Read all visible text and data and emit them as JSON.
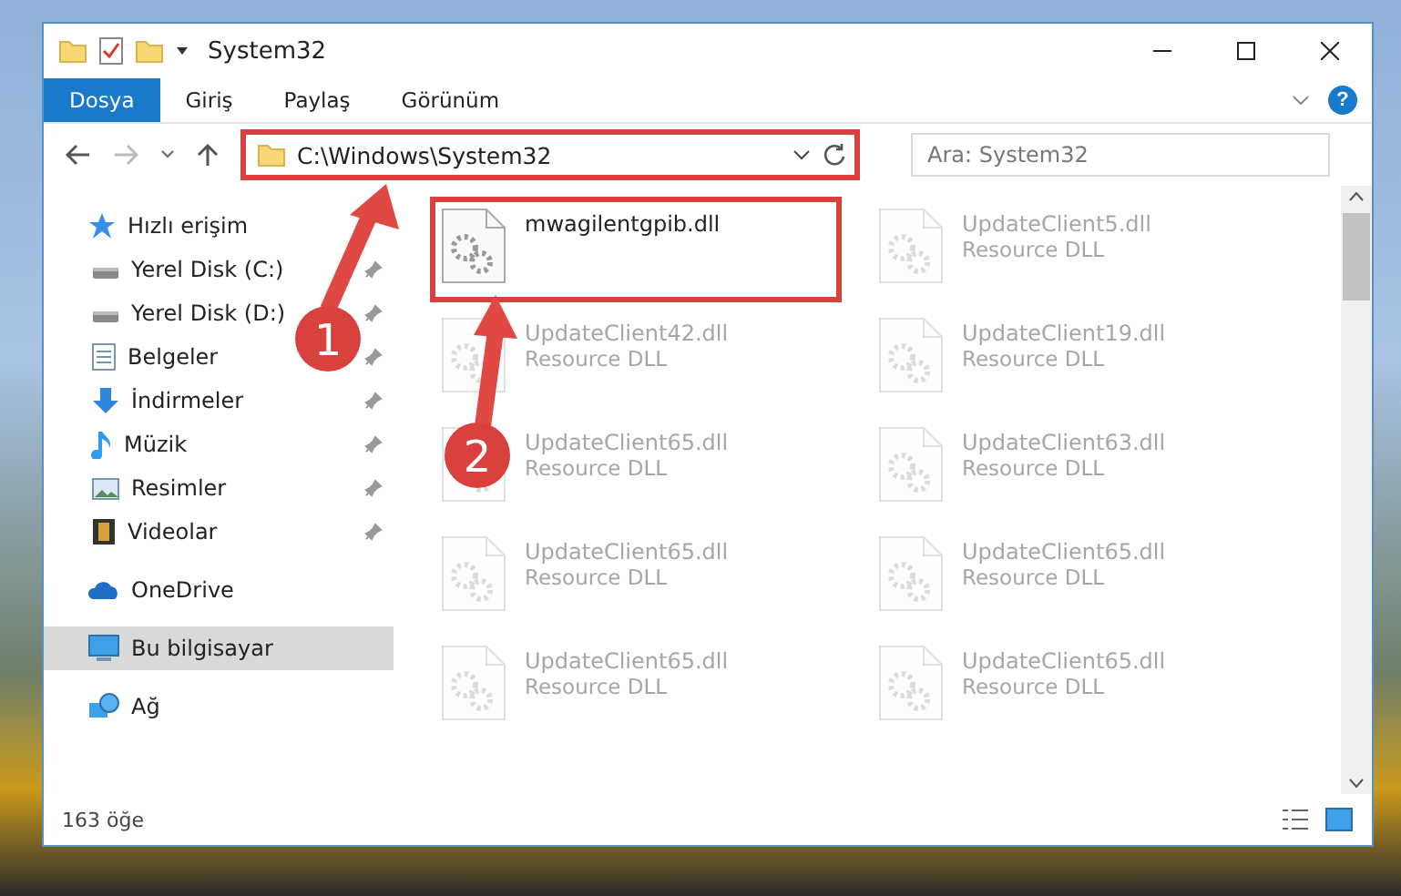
{
  "window": {
    "title": "System32"
  },
  "ribbon_tabs": [
    {
      "label": "Dosya",
      "selected": true
    },
    {
      "label": "Giriş",
      "selected": false
    },
    {
      "label": "Paylaş",
      "selected": false
    },
    {
      "label": "Görünüm",
      "selected": false
    }
  ],
  "help_button": {
    "label": "?"
  },
  "address_bar": {
    "path": "C:\\Windows\\System32",
    "highlighted": true
  },
  "search": {
    "placeholder": "Ara: System32"
  },
  "sidebar": {
    "items": [
      {
        "label": "Hızlı erişim",
        "kind": "star",
        "selected": false,
        "children": [
          {
            "label": "Yerel Disk (C:)",
            "kind": "drive",
            "pinned": true
          },
          {
            "label": "Yerel Disk (D:)",
            "kind": "drive",
            "pinned": true
          },
          {
            "label": "Belgeler",
            "kind": "document",
            "pinned": true
          },
          {
            "label": "İndirmeler",
            "kind": "download",
            "pinned": true
          },
          {
            "label": "Müzik",
            "kind": "music",
            "pinned": true
          },
          {
            "label": "Resimler",
            "kind": "picture",
            "pinned": true
          },
          {
            "label": "Videolar",
            "kind": "video",
            "pinned": true
          }
        ]
      },
      {
        "label": "OneDrive",
        "kind": "cloud",
        "selected": false
      },
      {
        "label": "Bu bilgisayar",
        "kind": "computer",
        "selected": true
      },
      {
        "label": "Ağ",
        "kind": "network",
        "selected": false
      }
    ]
  },
  "files": [
    {
      "name": "mwagilentgpib.dll",
      "highlighted": true,
      "faded": false
    },
    {
      "name": "UpdateClient5.dll",
      "type": "Resource DLL",
      "faded": true
    },
    {
      "name": "UpdateClient42.dll",
      "type": "Resource DLL",
      "faded": true
    },
    {
      "name": "UpdateClient19.dll",
      "type": "Resource DLL",
      "faded": true
    },
    {
      "name": "UpdateClient65.dll",
      "type": "Resource DLL",
      "faded": true
    },
    {
      "name": "UpdateClient63.dll",
      "type": "Resource DLL",
      "faded": true
    },
    {
      "name": "UpdateClient65.dll",
      "type": "Resource DLL",
      "faded": true
    },
    {
      "name": "UpdateClient65.dll",
      "type": "Resource DLL",
      "faded": true
    },
    {
      "name": "UpdateClient65.dll",
      "type": "Resource DLL",
      "faded": true
    },
    {
      "name": "UpdateClient65.dll",
      "type": "Resource DLL",
      "faded": true
    }
  ],
  "annotations": [
    {
      "number": "1"
    },
    {
      "number": "2"
    }
  ],
  "status_bar": {
    "count": "163 öğe"
  }
}
